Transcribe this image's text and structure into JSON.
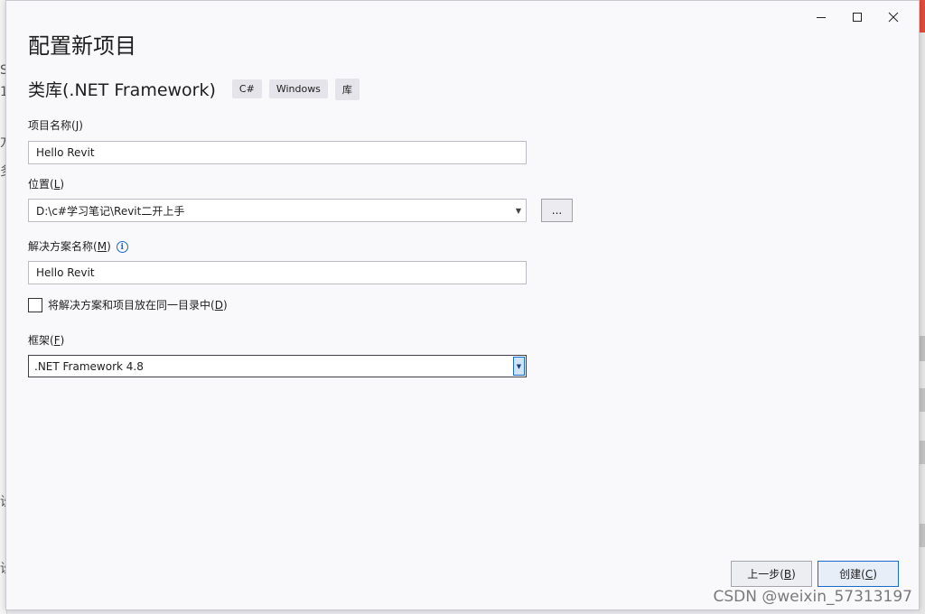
{
  "window": {
    "title": "配置新项目",
    "controls": [
      "minimize",
      "maximize",
      "close"
    ]
  },
  "template": {
    "name": "类库(.NET Framework)",
    "tags": [
      "C#",
      "Windows",
      "库"
    ]
  },
  "project_name": {
    "label": "项目名称",
    "accel": "J",
    "value": "Hello Revit"
  },
  "location": {
    "label": "位置",
    "accel": "L",
    "value": "D:\\c#学习笔记\\Revit二开上手",
    "browse_label": "..."
  },
  "solution_name": {
    "label": "解决方案名称",
    "accel": "M",
    "value": "Hello Revit"
  },
  "same_dir": {
    "label": "将解决方案和项目放在同一目录中",
    "accel": "D",
    "checked": false
  },
  "framework": {
    "label": "框架",
    "accel": "F",
    "value": ".NET Framework 4.8"
  },
  "footer": {
    "back_label": "上一步",
    "back_accel": "B",
    "create_label": "创建",
    "create_accel": "C"
  },
  "watermark": "CSDN @weixin_57313197",
  "colors": {
    "accent": "#1b6ac9",
    "dialog_bg": "#f9f9fb"
  }
}
